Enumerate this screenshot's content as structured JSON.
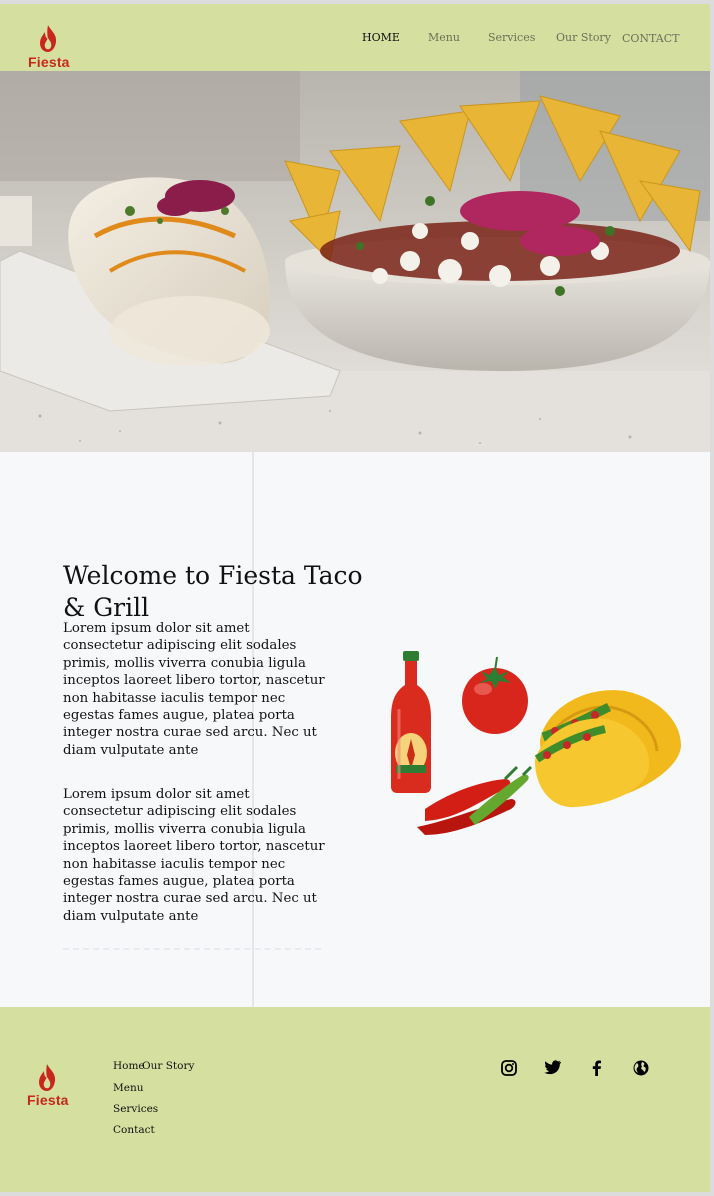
{
  "brand": {
    "logo_text": "Fiesta",
    "accent": "#c8281b",
    "header_bg": "#d5e0a0"
  },
  "nav": {
    "home": "HOME",
    "menu": "Menu",
    "services": "Services",
    "story": "Our Story",
    "contact": "CONTACT"
  },
  "welcome": {
    "title": "Welcome to Fiesta Taco & Grill",
    "para1": "Lorem ipsum dolor sit amet consectetur adipiscing elit sodales primis, mollis viverra conubia ligula inceptos laoreet libero tortor, nascetur non habitasse iaculis tempor nec egestas fames augue, platea porta integer nostra curae sed arcu. Nec ut diam vulputate ante",
    "para2": "Lorem ipsum dolor sit amet consectetur adipiscing elit sodales primis, mollis viverra conubia ligula inceptos laoreet libero tortor, nascetur non habitasse iaculis tempor nec egestas fames augue, platea porta integer nostra curae sed arcu. Nec ut diam vulputate ante"
  },
  "footer": {
    "logo_text": "Fiesta",
    "links": {
      "home": "Home",
      "story": "Our Story",
      "menu": "Menu",
      "services": "Services",
      "contact": "Contact"
    },
    "social": [
      "instagram-icon",
      "twitter-icon",
      "facebook-icon",
      "globe-icon"
    ]
  }
}
